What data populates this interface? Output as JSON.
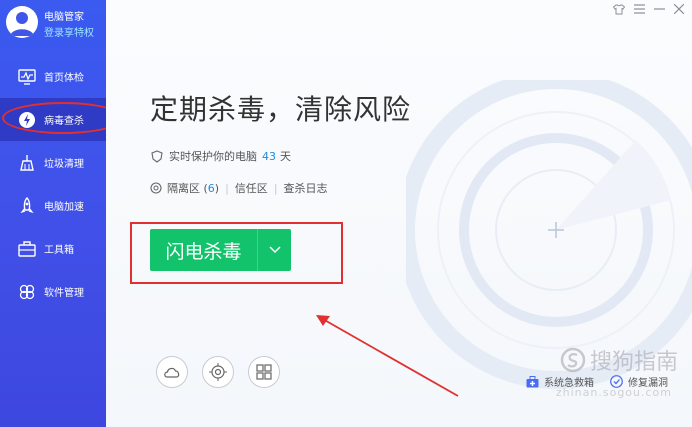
{
  "user": {
    "name": "电脑管家",
    "subtitle": "登录享特权"
  },
  "sidebar": {
    "items": [
      {
        "label": "首页体检",
        "icon": "monitor-icon",
        "active": false
      },
      {
        "label": "病毒查杀",
        "icon": "lightning-shield-icon",
        "active": true
      },
      {
        "label": "垃圾清理",
        "icon": "broom-icon",
        "active": false
      },
      {
        "label": "电脑加速",
        "icon": "rocket-icon",
        "active": false
      },
      {
        "label": "工具箱",
        "icon": "toolbox-icon",
        "active": false
      },
      {
        "label": "软件管理",
        "icon": "puzzle-icon",
        "active": false
      }
    ]
  },
  "main": {
    "headline": "定期杀毒，清除风险",
    "protect_prefix": "实时保护你的电脑",
    "protect_days": "43",
    "protect_suffix": "天",
    "quarantine_label": "隔离区 (",
    "quarantine_count": "6",
    "quarantine_close": ")",
    "trust_label": "信任区",
    "log_label": "查杀日志",
    "scan_button": "闪电杀毒"
  },
  "bottom_right": {
    "rescue": "系统急救箱",
    "repair": "修复漏洞"
  },
  "watermark": {
    "text": "搜狗指南",
    "url": "zhinan.sogou.com"
  },
  "colors": {
    "sidebar": "#3a5af0",
    "sidebar_active": "#2f3bc4",
    "accent_green": "#12c36b",
    "annotation_red": "#e0302f",
    "link_blue": "#1f8be0"
  }
}
